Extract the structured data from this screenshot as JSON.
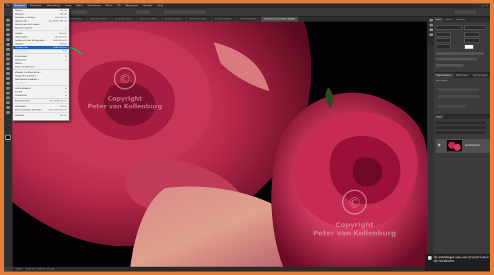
{
  "menubar": {
    "items": [
      "Bestand",
      "Bewerken",
      "Afbeelding",
      "Laag",
      "Tekst",
      "Selecteren",
      "Filter",
      "3D",
      "Weergave",
      "Venster",
      "Help"
    ]
  },
  "tabs": [
    "20191015-IMG4...",
    "20191015-IMG4...",
    "20191015-IMG4...",
    "20191015-IMG4...",
    "20191015-IMG4...",
    "20191015-IMG4...",
    "20191015-IMG4...",
    "20191015-IMG4...",
    "20191015-IMG4...",
    "20191015-IMG4...",
    "Naamloos-1 @ 100% (RGB/8)"
  ],
  "file_menu": [
    {
      "label": "Nieuw...",
      "shortcut": "Ctrl+N",
      "state": "normal"
    },
    {
      "label": "Openen...",
      "shortcut": "Ctrl+O",
      "state": "normal"
    },
    {
      "label": "Bladeren in Bridge...",
      "shortcut": "Alt+Ctrl+O",
      "state": "normal"
    },
    {
      "label": "Openen als...",
      "shortcut": "Alt+Shift+Ctrl+O",
      "state": "normal"
    },
    {
      "label": "Openen als slim object...",
      "shortcut": "",
      "state": "normal"
    },
    {
      "label": "Recente openen",
      "shortcut": "▸",
      "state": "normal"
    },
    {
      "sep": true
    },
    {
      "label": "Sluiten",
      "shortcut": "Ctrl+W",
      "state": "normal"
    },
    {
      "label": "Alles sluiten",
      "shortcut": "Alt+Ctrl+W",
      "state": "normal"
    },
    {
      "label": "Sluiten en naar Bridge gaan...",
      "shortcut": "Shift+Ctrl+W",
      "state": "normal"
    },
    {
      "label": "Opslaan",
      "shortcut": "Ctrl+S",
      "state": "normal"
    },
    {
      "label": "Opslaan als...",
      "shortcut": "Shift+Ctrl+S",
      "state": "selected"
    },
    {
      "label": "Vorige versie",
      "shortcut": "F12",
      "state": "disabled"
    },
    {
      "sep": true
    },
    {
      "label": "Exporteren",
      "shortcut": "▸",
      "state": "normal"
    },
    {
      "label": "Genereren",
      "shortcut": "▸",
      "state": "normal"
    },
    {
      "label": "Delen...",
      "shortcut": "",
      "state": "normal"
    },
    {
      "label": "Delen op Behance...",
      "shortcut": "",
      "state": "normal"
    },
    {
      "sep": true
    },
    {
      "label": "Zoeken in Adobe Stock...",
      "shortcut": "",
      "state": "normal"
    },
    {
      "label": "Ingesloten plaatsen...",
      "shortcut": "",
      "state": "normal"
    },
    {
      "label": "Gekoppelde plaatsen...",
      "shortcut": "",
      "state": "normal"
    },
    {
      "label": "Verpakken...",
      "shortcut": "",
      "state": "disabled"
    },
    {
      "sep": true
    },
    {
      "label": "Automatiseren",
      "shortcut": "▸",
      "state": "normal"
    },
    {
      "label": "Scripts",
      "shortcut": "▸",
      "state": "normal"
    },
    {
      "label": "Importeren",
      "shortcut": "▸",
      "state": "normal"
    },
    {
      "sep": true
    },
    {
      "label": "Bestandsinfo...",
      "shortcut": "Alt+Shift+Ctrl+I",
      "state": "normal"
    },
    {
      "sep": true
    },
    {
      "label": "Afdrukken...",
      "shortcut": "Ctrl+P",
      "state": "normal"
    },
    {
      "label": "Eén exemplaar afdrukken",
      "shortcut": "Alt+Shift+Ctrl+P",
      "state": "normal"
    },
    {
      "sep": true
    },
    {
      "label": "Afsluiten",
      "shortcut": "Ctrl+Q",
      "state": "normal"
    }
  ],
  "watermark": {
    "line1": "Copyright",
    "line2": "Peter van Kollenburg",
    "symbol": "©"
  },
  "panels": {
    "top_tabs": [
      "Kleur",
      "Stalen",
      "Verlopen"
    ],
    "mid_tabs": [
      "Eigenschappen",
      "Bibliotheken",
      "Aanpassingen"
    ],
    "mid_title": "Document",
    "layers_tab": "Lagen",
    "layer_name": "Achtergrond"
  },
  "status": {
    "zoom": "100%",
    "info": "2048 px x 1365 px (72 ppi)"
  },
  "toast": {
    "text": "De instellingen voor een account Gmail zijn verzonden."
  },
  "colors": {
    "frame": "#e0803a",
    "arrow": "#22b14c",
    "menu_highlight": "#1f64c8"
  }
}
